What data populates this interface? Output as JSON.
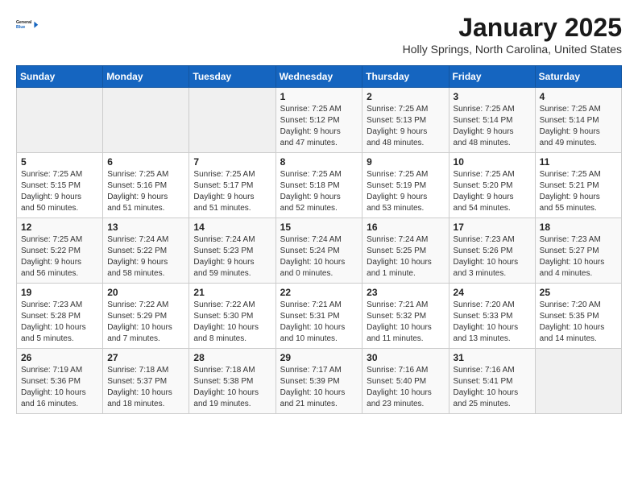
{
  "header": {
    "logo_line1": "General",
    "logo_line2": "Blue",
    "month": "January 2025",
    "location": "Holly Springs, North Carolina, United States"
  },
  "weekdays": [
    "Sunday",
    "Monday",
    "Tuesday",
    "Wednesday",
    "Thursday",
    "Friday",
    "Saturday"
  ],
  "weeks": [
    [
      {
        "day": "",
        "info": ""
      },
      {
        "day": "",
        "info": ""
      },
      {
        "day": "",
        "info": ""
      },
      {
        "day": "1",
        "info": "Sunrise: 7:25 AM\nSunset: 5:12 PM\nDaylight: 9 hours\nand 47 minutes."
      },
      {
        "day": "2",
        "info": "Sunrise: 7:25 AM\nSunset: 5:13 PM\nDaylight: 9 hours\nand 48 minutes."
      },
      {
        "day": "3",
        "info": "Sunrise: 7:25 AM\nSunset: 5:14 PM\nDaylight: 9 hours\nand 48 minutes."
      },
      {
        "day": "4",
        "info": "Sunrise: 7:25 AM\nSunset: 5:14 PM\nDaylight: 9 hours\nand 49 minutes."
      }
    ],
    [
      {
        "day": "5",
        "info": "Sunrise: 7:25 AM\nSunset: 5:15 PM\nDaylight: 9 hours\nand 50 minutes."
      },
      {
        "day": "6",
        "info": "Sunrise: 7:25 AM\nSunset: 5:16 PM\nDaylight: 9 hours\nand 51 minutes."
      },
      {
        "day": "7",
        "info": "Sunrise: 7:25 AM\nSunset: 5:17 PM\nDaylight: 9 hours\nand 51 minutes."
      },
      {
        "day": "8",
        "info": "Sunrise: 7:25 AM\nSunset: 5:18 PM\nDaylight: 9 hours\nand 52 minutes."
      },
      {
        "day": "9",
        "info": "Sunrise: 7:25 AM\nSunset: 5:19 PM\nDaylight: 9 hours\nand 53 minutes."
      },
      {
        "day": "10",
        "info": "Sunrise: 7:25 AM\nSunset: 5:20 PM\nDaylight: 9 hours\nand 54 minutes."
      },
      {
        "day": "11",
        "info": "Sunrise: 7:25 AM\nSunset: 5:21 PM\nDaylight: 9 hours\nand 55 minutes."
      }
    ],
    [
      {
        "day": "12",
        "info": "Sunrise: 7:25 AM\nSunset: 5:22 PM\nDaylight: 9 hours\nand 56 minutes."
      },
      {
        "day": "13",
        "info": "Sunrise: 7:24 AM\nSunset: 5:22 PM\nDaylight: 9 hours\nand 58 minutes."
      },
      {
        "day": "14",
        "info": "Sunrise: 7:24 AM\nSunset: 5:23 PM\nDaylight: 9 hours\nand 59 minutes."
      },
      {
        "day": "15",
        "info": "Sunrise: 7:24 AM\nSunset: 5:24 PM\nDaylight: 10 hours\nand 0 minutes."
      },
      {
        "day": "16",
        "info": "Sunrise: 7:24 AM\nSunset: 5:25 PM\nDaylight: 10 hours\nand 1 minute."
      },
      {
        "day": "17",
        "info": "Sunrise: 7:23 AM\nSunset: 5:26 PM\nDaylight: 10 hours\nand 3 minutes."
      },
      {
        "day": "18",
        "info": "Sunrise: 7:23 AM\nSunset: 5:27 PM\nDaylight: 10 hours\nand 4 minutes."
      }
    ],
    [
      {
        "day": "19",
        "info": "Sunrise: 7:23 AM\nSunset: 5:28 PM\nDaylight: 10 hours\nand 5 minutes."
      },
      {
        "day": "20",
        "info": "Sunrise: 7:22 AM\nSunset: 5:29 PM\nDaylight: 10 hours\nand 7 minutes."
      },
      {
        "day": "21",
        "info": "Sunrise: 7:22 AM\nSunset: 5:30 PM\nDaylight: 10 hours\nand 8 minutes."
      },
      {
        "day": "22",
        "info": "Sunrise: 7:21 AM\nSunset: 5:31 PM\nDaylight: 10 hours\nand 10 minutes."
      },
      {
        "day": "23",
        "info": "Sunrise: 7:21 AM\nSunset: 5:32 PM\nDaylight: 10 hours\nand 11 minutes."
      },
      {
        "day": "24",
        "info": "Sunrise: 7:20 AM\nSunset: 5:33 PM\nDaylight: 10 hours\nand 13 minutes."
      },
      {
        "day": "25",
        "info": "Sunrise: 7:20 AM\nSunset: 5:35 PM\nDaylight: 10 hours\nand 14 minutes."
      }
    ],
    [
      {
        "day": "26",
        "info": "Sunrise: 7:19 AM\nSunset: 5:36 PM\nDaylight: 10 hours\nand 16 minutes."
      },
      {
        "day": "27",
        "info": "Sunrise: 7:18 AM\nSunset: 5:37 PM\nDaylight: 10 hours\nand 18 minutes."
      },
      {
        "day": "28",
        "info": "Sunrise: 7:18 AM\nSunset: 5:38 PM\nDaylight: 10 hours\nand 19 minutes."
      },
      {
        "day": "29",
        "info": "Sunrise: 7:17 AM\nSunset: 5:39 PM\nDaylight: 10 hours\nand 21 minutes."
      },
      {
        "day": "30",
        "info": "Sunrise: 7:16 AM\nSunset: 5:40 PM\nDaylight: 10 hours\nand 23 minutes."
      },
      {
        "day": "31",
        "info": "Sunrise: 7:16 AM\nSunset: 5:41 PM\nDaylight: 10 hours\nand 25 minutes."
      },
      {
        "day": "",
        "info": ""
      }
    ]
  ]
}
